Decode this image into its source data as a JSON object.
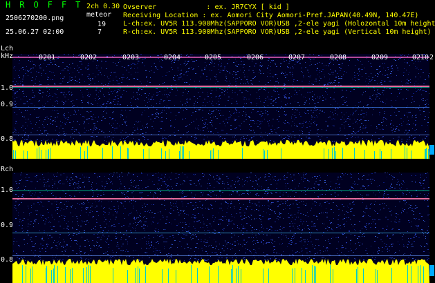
{
  "header": {
    "title": "HROFFT",
    "version": "2ch 0.30",
    "meteor_label": "meteor",
    "filename": "2506270200.png",
    "datetime": "25.06.27 02:00",
    "count_l": "19",
    "count_r": "7",
    "observer": "Ovserver            : ex. JR7CYX [ kid ]",
    "location": "Receiving Location : ex. Aomori City Aomori-Pref.JAPAN(40.49N, 140.47E)",
    "lch_info": "L-ch:ex. UV5R 113.900Mhz(SAPPORO VOR)USB ,2-ele yagi (Holozontal 10m height",
    "rch_info": "R-ch:ex. UV5R 113.900Mhz(SAPPORO VOR)USB ,2-ele yagi (Vertical 10m height)"
  },
  "lch": {
    "label": "Lch",
    "unit": "kHz"
  },
  "rch": {
    "label": "Rch"
  },
  "freq_ticks": [
    "1.0",
    "0.9",
    "0.8"
  ],
  "time_labels": [
    "0201",
    "0202",
    "0203",
    "0204",
    "0205",
    "0206",
    "0207",
    "0208",
    "0209",
    "0210"
  ],
  "end_mark": "2",
  "colors": {
    "accent": "#ffff00",
    "title": "#00ff00",
    "noise": "#1a2a9a",
    "marker": "#00aaff"
  }
}
